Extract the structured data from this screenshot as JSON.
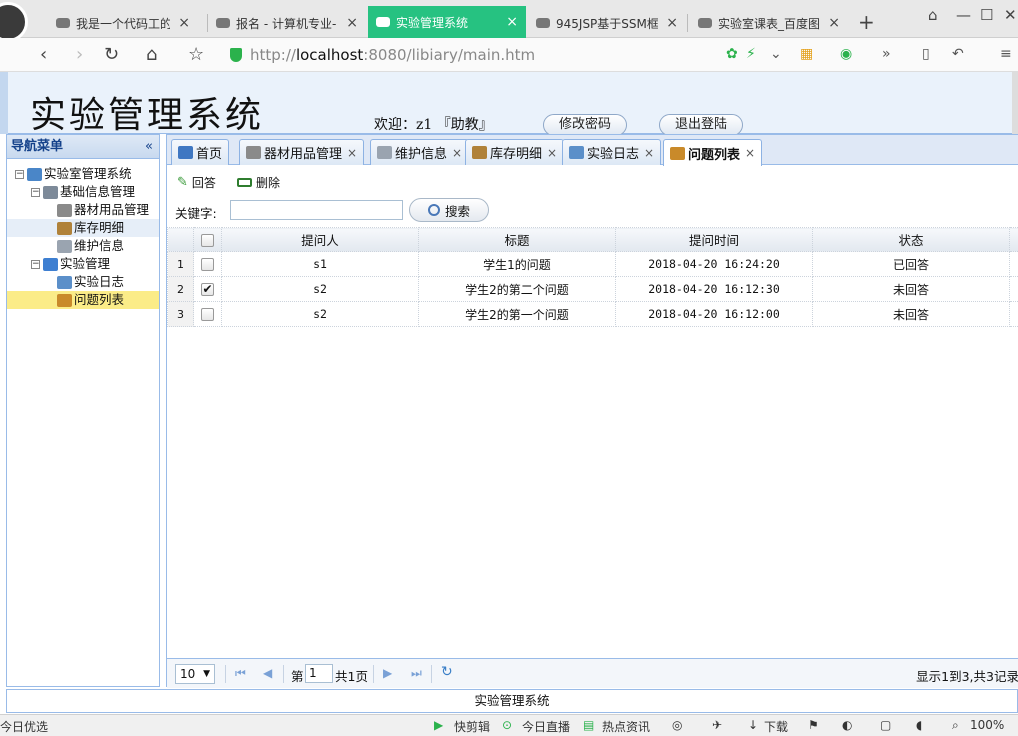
{
  "browser": {
    "tabs": [
      {
        "title": "我是一个代码工的S",
        "active": false
      },
      {
        "title": "报名 - 计算机专业-",
        "active": false
      },
      {
        "title": "实验管理系统",
        "active": true
      },
      {
        "title": "945JSP基于SSM框",
        "active": false
      },
      {
        "title": "实验室课表_百度图",
        "active": false
      }
    ],
    "close_glyph": "×",
    "new_tab": "+",
    "url_prefix": "http://",
    "url_host": "localhost",
    "url_rest": ":8080/libiary/main.htm"
  },
  "header": {
    "title": "实验管理系统",
    "welcome": "欢迎：z1 『助教』",
    "change_password": "修改密码",
    "logout": "退出登陆"
  },
  "nav": {
    "title": "导航菜单",
    "collapse_glyph": "«",
    "items": [
      {
        "label": "实验室管理系统",
        "level": 0,
        "toggle": "−",
        "icon_color": "#4a86c8"
      },
      {
        "label": "基础信息管理",
        "level": 1,
        "toggle": "−",
        "icon_color": "#7d8a99"
      },
      {
        "label": "器材用品管理",
        "level": 2,
        "icon_color": "#8a8a8a"
      },
      {
        "label": "库存明细",
        "level": 2,
        "icon_color": "#b0823a"
      },
      {
        "label": "维护信息",
        "level": 2,
        "icon_color": "#9aa4b0"
      },
      {
        "label": "实验管理",
        "level": 1,
        "toggle": "−",
        "icon_color": "#3e7fd1"
      },
      {
        "label": "实验日志",
        "level": 2,
        "icon_color": "#5b8fc9"
      },
      {
        "label": "问题列表",
        "level": 2,
        "icon_color": "#c98a2a"
      }
    ]
  },
  "page_tabs": [
    {
      "label": "首页",
      "closable": false,
      "icon_color": "#3f77c2"
    },
    {
      "label": "器材用品管理",
      "closable": true,
      "icon_color": "#8a8a8a"
    },
    {
      "label": "维护信息",
      "closable": true,
      "icon_color": "#9aa4b0"
    },
    {
      "label": "库存明细",
      "closable": true,
      "icon_color": "#b0823a"
    },
    {
      "label": "实验日志",
      "closable": true,
      "icon_color": "#5b8fc9"
    },
    {
      "label": "问题列表",
      "closable": true,
      "icon_color": "#c98a2a",
      "active": true
    }
  ],
  "toolbar": {
    "reply": "回答",
    "delete": "删除"
  },
  "search": {
    "label": "关键字:",
    "value": "",
    "button": "搜索"
  },
  "grid": {
    "columns": [
      "提问人",
      "标题",
      "提问时间",
      "状态"
    ],
    "rows": [
      {
        "num": "1",
        "checked": false,
        "asker": "s1",
        "title": "学生1的问题",
        "time": "2018-04-20 16:24:20",
        "status": "已回答"
      },
      {
        "num": "2",
        "checked": true,
        "asker": "s2",
        "title": "学生2的第二个问题",
        "time": "2018-04-20 16:12:30",
        "status": "未回答"
      },
      {
        "num": "3",
        "checked": false,
        "asker": "s2",
        "title": "学生2的第一个问题",
        "time": "2018-04-20 16:12:00",
        "status": "未回答"
      }
    ]
  },
  "pager": {
    "page_size": "10",
    "page_prefix": "第",
    "page_value": "1",
    "page_suffix": "共1页",
    "info": "显示1到3,共3记录"
  },
  "footer": {
    "text": "实验管理系统"
  },
  "statusbar": {
    "left": "今日优选",
    "items": [
      "快剪辑",
      "今日直播",
      "热点资讯",
      "下载"
    ],
    "zoom": "100%"
  }
}
